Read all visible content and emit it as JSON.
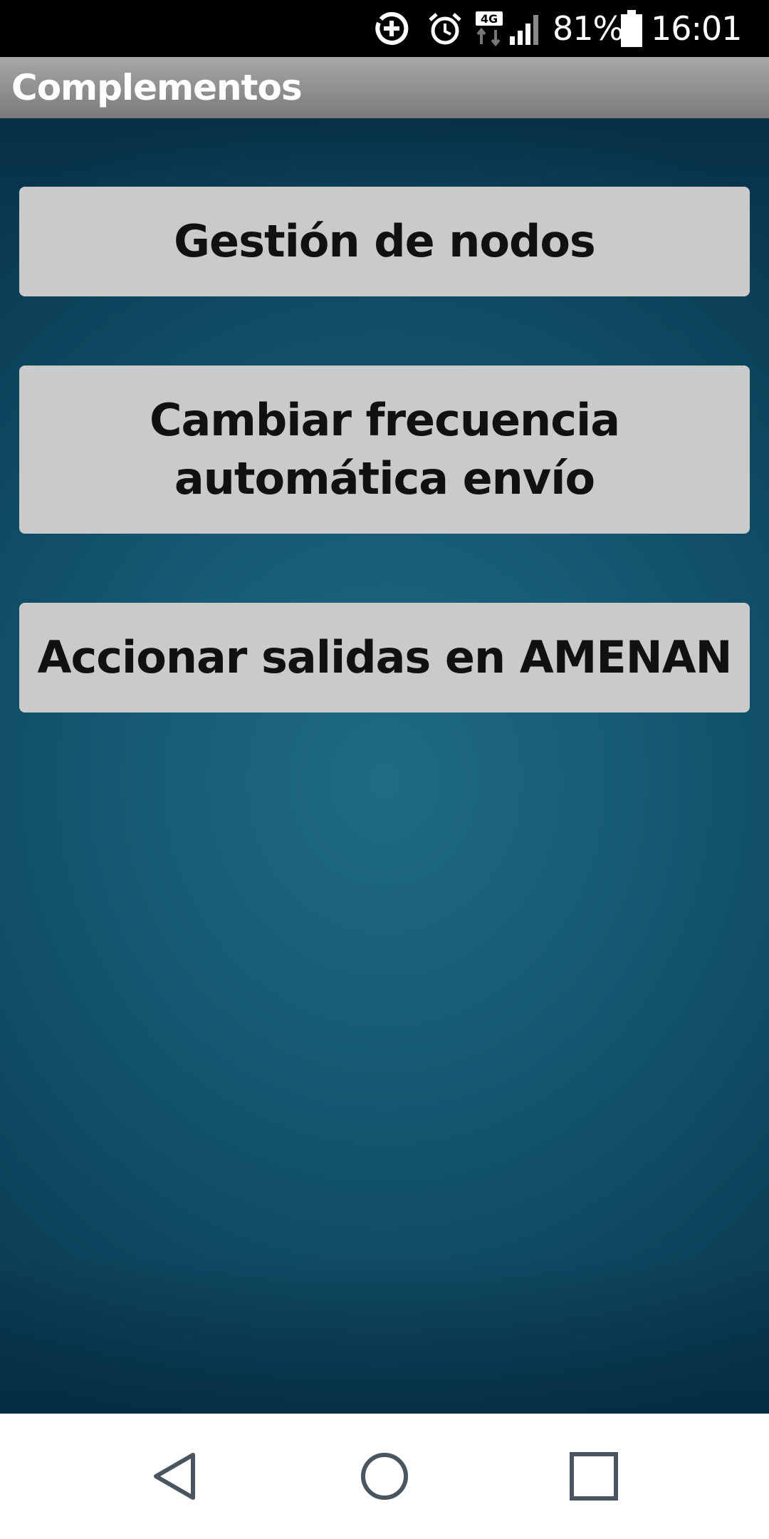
{
  "status_bar": {
    "battery_percent": "81%",
    "time": "16:01",
    "network": "4G",
    "icons": [
      "data-saver-icon",
      "alarm-icon",
      "network-4g-icon",
      "signal-icon",
      "battery-icon"
    ]
  },
  "app": {
    "title": "Complementos"
  },
  "menu": {
    "buttons": [
      {
        "label": "Gestión de nodos"
      },
      {
        "label": "Cambiar frecuencia\nautomática envío"
      },
      {
        "label": "Accionar salidas en AMENAN"
      }
    ]
  },
  "navigation": {
    "icons": [
      "back-icon",
      "home-icon",
      "recents-icon"
    ]
  },
  "colors": {
    "button_bg": "#cacaca",
    "background_center": "#206b84",
    "background_edge": "#0a3850",
    "title_bar": "#8f8f8f"
  }
}
